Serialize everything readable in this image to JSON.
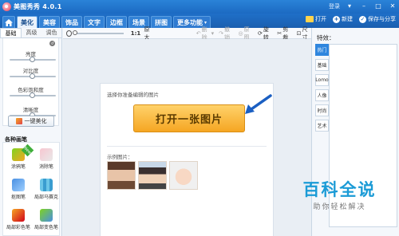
{
  "window": {
    "title": "美图秀秀 4.0.1",
    "login": "登录"
  },
  "tabs": [
    {
      "label": "美化",
      "active": true
    },
    {
      "label": "美容"
    },
    {
      "label": "饰品"
    },
    {
      "label": "文字"
    },
    {
      "label": "边框"
    },
    {
      "label": "场景"
    },
    {
      "label": "拼图"
    },
    {
      "label": "更多功能"
    }
  ],
  "header_actions": {
    "open": "打开",
    "new": "新建",
    "save_share": "保存与分享"
  },
  "left_panel": {
    "subtabs": [
      "基础",
      "高级",
      "调色"
    ],
    "sliders": [
      {
        "label": "亮度",
        "value": 0.5
      },
      {
        "label": "对比度",
        "value": 0.5
      },
      {
        "label": "色彩饱和度",
        "value": 0.5
      },
      {
        "label": "清晰度",
        "value": 0.5
      }
    ],
    "one_key_button": "一键美化",
    "brush_section_title": "各种画笔",
    "new_badge": "New",
    "brushes": [
      "涂鸦笔",
      "消除笔",
      "抠图笔",
      "局部马赛克",
      "局部彩色笔",
      "局部变色笔"
    ]
  },
  "toolbar": {
    "zoom_ratio": "1:1",
    "original_size": "原大",
    "delete": "删除",
    "undo": "撤销",
    "restore": "原图",
    "rotate": "旋转",
    "crop": "剪裁",
    "resize": "尺寸"
  },
  "canvas": {
    "hint": "选择你准备编辑的图片",
    "open_button": "打开一张图片",
    "example_label": "示例图片："
  },
  "right_panel": {
    "title": "特效：",
    "tabs": [
      {
        "label": "热门",
        "active": true
      },
      {
        "label": "基础"
      },
      {
        "label": "Lomo"
      },
      {
        "label": "人像"
      },
      {
        "label": "时尚"
      },
      {
        "label": "艺术"
      }
    ]
  },
  "watermark": {
    "main": "百科全说",
    "sub": "助你轻松解决"
  }
}
